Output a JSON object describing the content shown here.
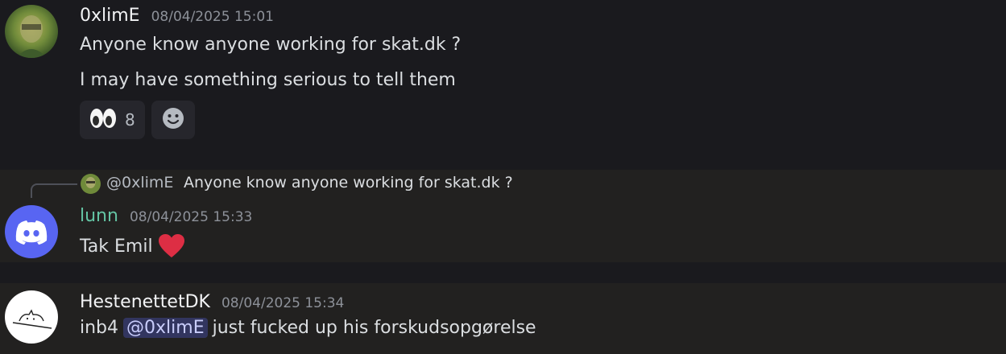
{
  "messages": [
    {
      "username": "0xlimE",
      "timestamp": "08/04/2025 15:01",
      "lines": [
        "Anyone know anyone working for skat.dk ?",
        "I may have something serious to tell them"
      ],
      "reactions": [
        {
          "emoji": "eyes-emoji",
          "count": "8"
        }
      ]
    },
    {
      "username": "lunn",
      "username_color": "#64c5a4",
      "timestamp": "08/04/2025 15:33",
      "reply": {
        "mention": "@0xlimE",
        "text": "Anyone know anyone working for skat.dk ?"
      },
      "text": "Tak Emil",
      "emoji": "heart-emoji"
    },
    {
      "username": "HestenettetDK",
      "timestamp": "08/04/2025 15:34",
      "text_before": "inb4",
      "mention": "@0xlimE",
      "text_after": "just fucked up his forskudsopgørelse"
    }
  ],
  "colors": {
    "background": "#1a1a1e",
    "highlight_row": "#222120",
    "accent": "#5865f2",
    "mention_bg": "#3c3f77"
  }
}
